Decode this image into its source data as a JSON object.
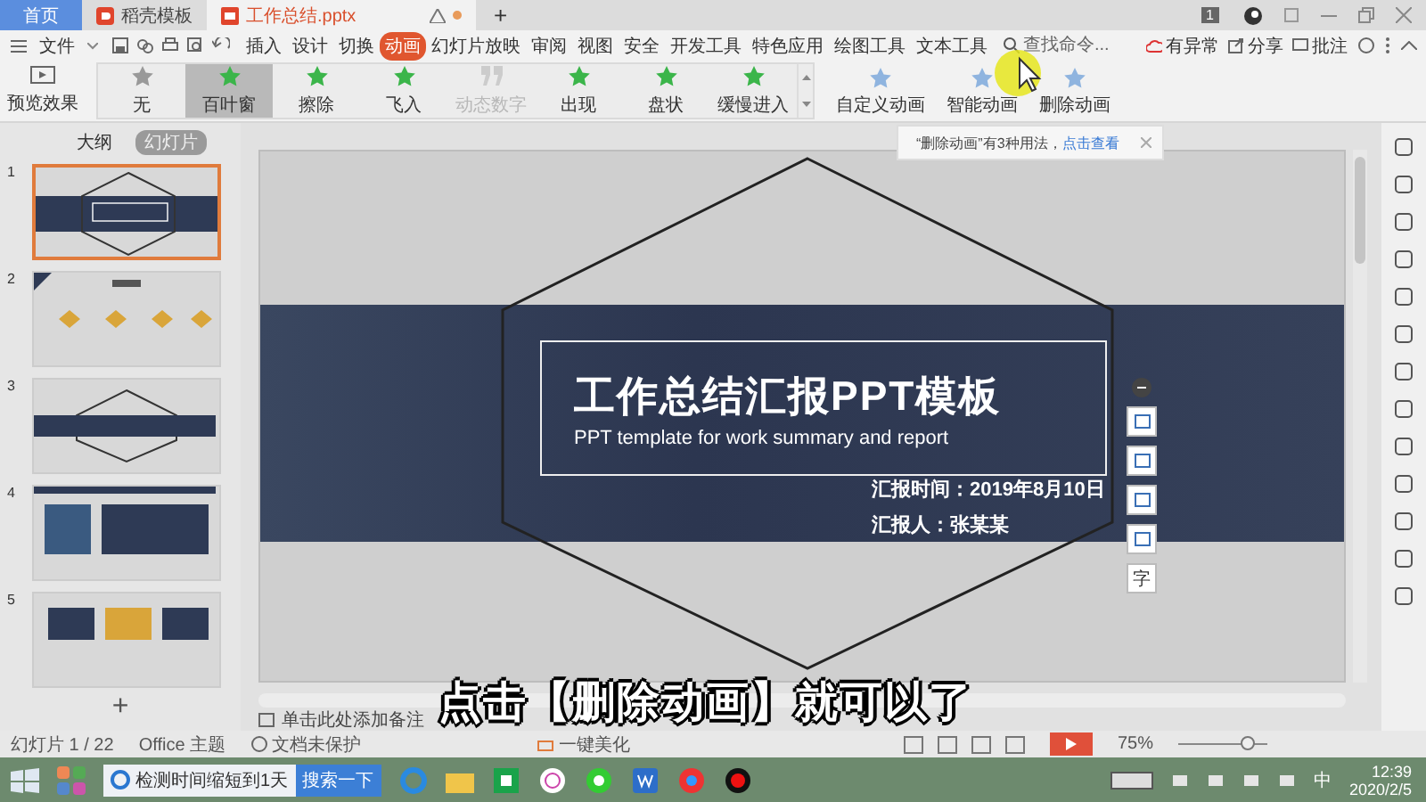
{
  "document_tabs": [
    {
      "label": "首页",
      "kind": "home",
      "selected": false
    },
    {
      "label": "稻壳模板",
      "kind": "app",
      "selected": false
    },
    {
      "label": "工作总结.pptx",
      "kind": "doc",
      "selected": true
    }
  ],
  "new_tab": "+",
  "account_badge": "1",
  "menu": {
    "file": "文件",
    "tabs": [
      {
        "label": "插入",
        "selected": false
      },
      {
        "label": "设计",
        "selected": false
      },
      {
        "label": "切换",
        "selected": false
      },
      {
        "label": "动画",
        "selected": true
      },
      {
        "label": "幻灯片放映",
        "selected": false
      },
      {
        "label": "审阅",
        "selected": false
      },
      {
        "label": "视图",
        "selected": false
      },
      {
        "label": "安全",
        "selected": false
      },
      {
        "label": "开发工具",
        "selected": false
      },
      {
        "label": "特色应用",
        "selected": false
      },
      {
        "label": "绘图工具",
        "selected": false
      },
      {
        "label": "文本工具",
        "selected": false
      }
    ],
    "search_placeholder": "查找命令...",
    "actions": [
      "有异常",
      "分享",
      "批注"
    ]
  },
  "ribbon": {
    "preview": "预览效果",
    "effects": [
      {
        "label": "无",
        "selected": false,
        "disabled": false
      },
      {
        "label": "百叶窗",
        "selected": true,
        "disabled": false
      },
      {
        "label": "擦除",
        "selected": false,
        "disabled": false
      },
      {
        "label": "飞入",
        "selected": false,
        "disabled": false
      },
      {
        "label": "动态数字",
        "selected": false,
        "disabled": true
      },
      {
        "label": "出现",
        "selected": false,
        "disabled": false
      },
      {
        "label": "盘状",
        "selected": false,
        "disabled": false
      },
      {
        "label": "缓慢进入",
        "selected": false,
        "disabled": false
      }
    ],
    "tools": [
      "自定义动画",
      "智能动画",
      "删除动画"
    ]
  },
  "tooltip": {
    "text": "“删除动画”有3种用法，",
    "link": "点击查看"
  },
  "slide_panel": {
    "tabs": [
      {
        "label": "大纲",
        "selected": false
      },
      {
        "label": "幻灯片",
        "selected": true
      }
    ],
    "slides": [
      {
        "number": "1",
        "selected": true
      },
      {
        "number": "2",
        "selected": false
      },
      {
        "number": "3",
        "selected": false
      },
      {
        "number": "4",
        "selected": false
      },
      {
        "number": "5",
        "selected": false
      }
    ],
    "add": "+"
  },
  "slide": {
    "title": "工作总结汇报PPT模板",
    "subtitle": "PPT template for work summary and report",
    "date": "汇报时间：2019年8月10日",
    "reporter": "汇报人：张某某",
    "text_tool": "字"
  },
  "notes_placeholder": "单击此处添加备注",
  "caption": "点击【删除动画】就可以了",
  "status_bar": {
    "slide": "幻灯片 1 / 22",
    "theme": "Office 主题",
    "protection": "文档未保护",
    "beautify": "一键美化",
    "zoom": "75%",
    "level": 0.8
  },
  "taskbar": {
    "window": "检测时间缩短到1天",
    "search_button": "搜索一下",
    "ime": "中",
    "time": "12:39",
    "date": "2020/2/5"
  }
}
